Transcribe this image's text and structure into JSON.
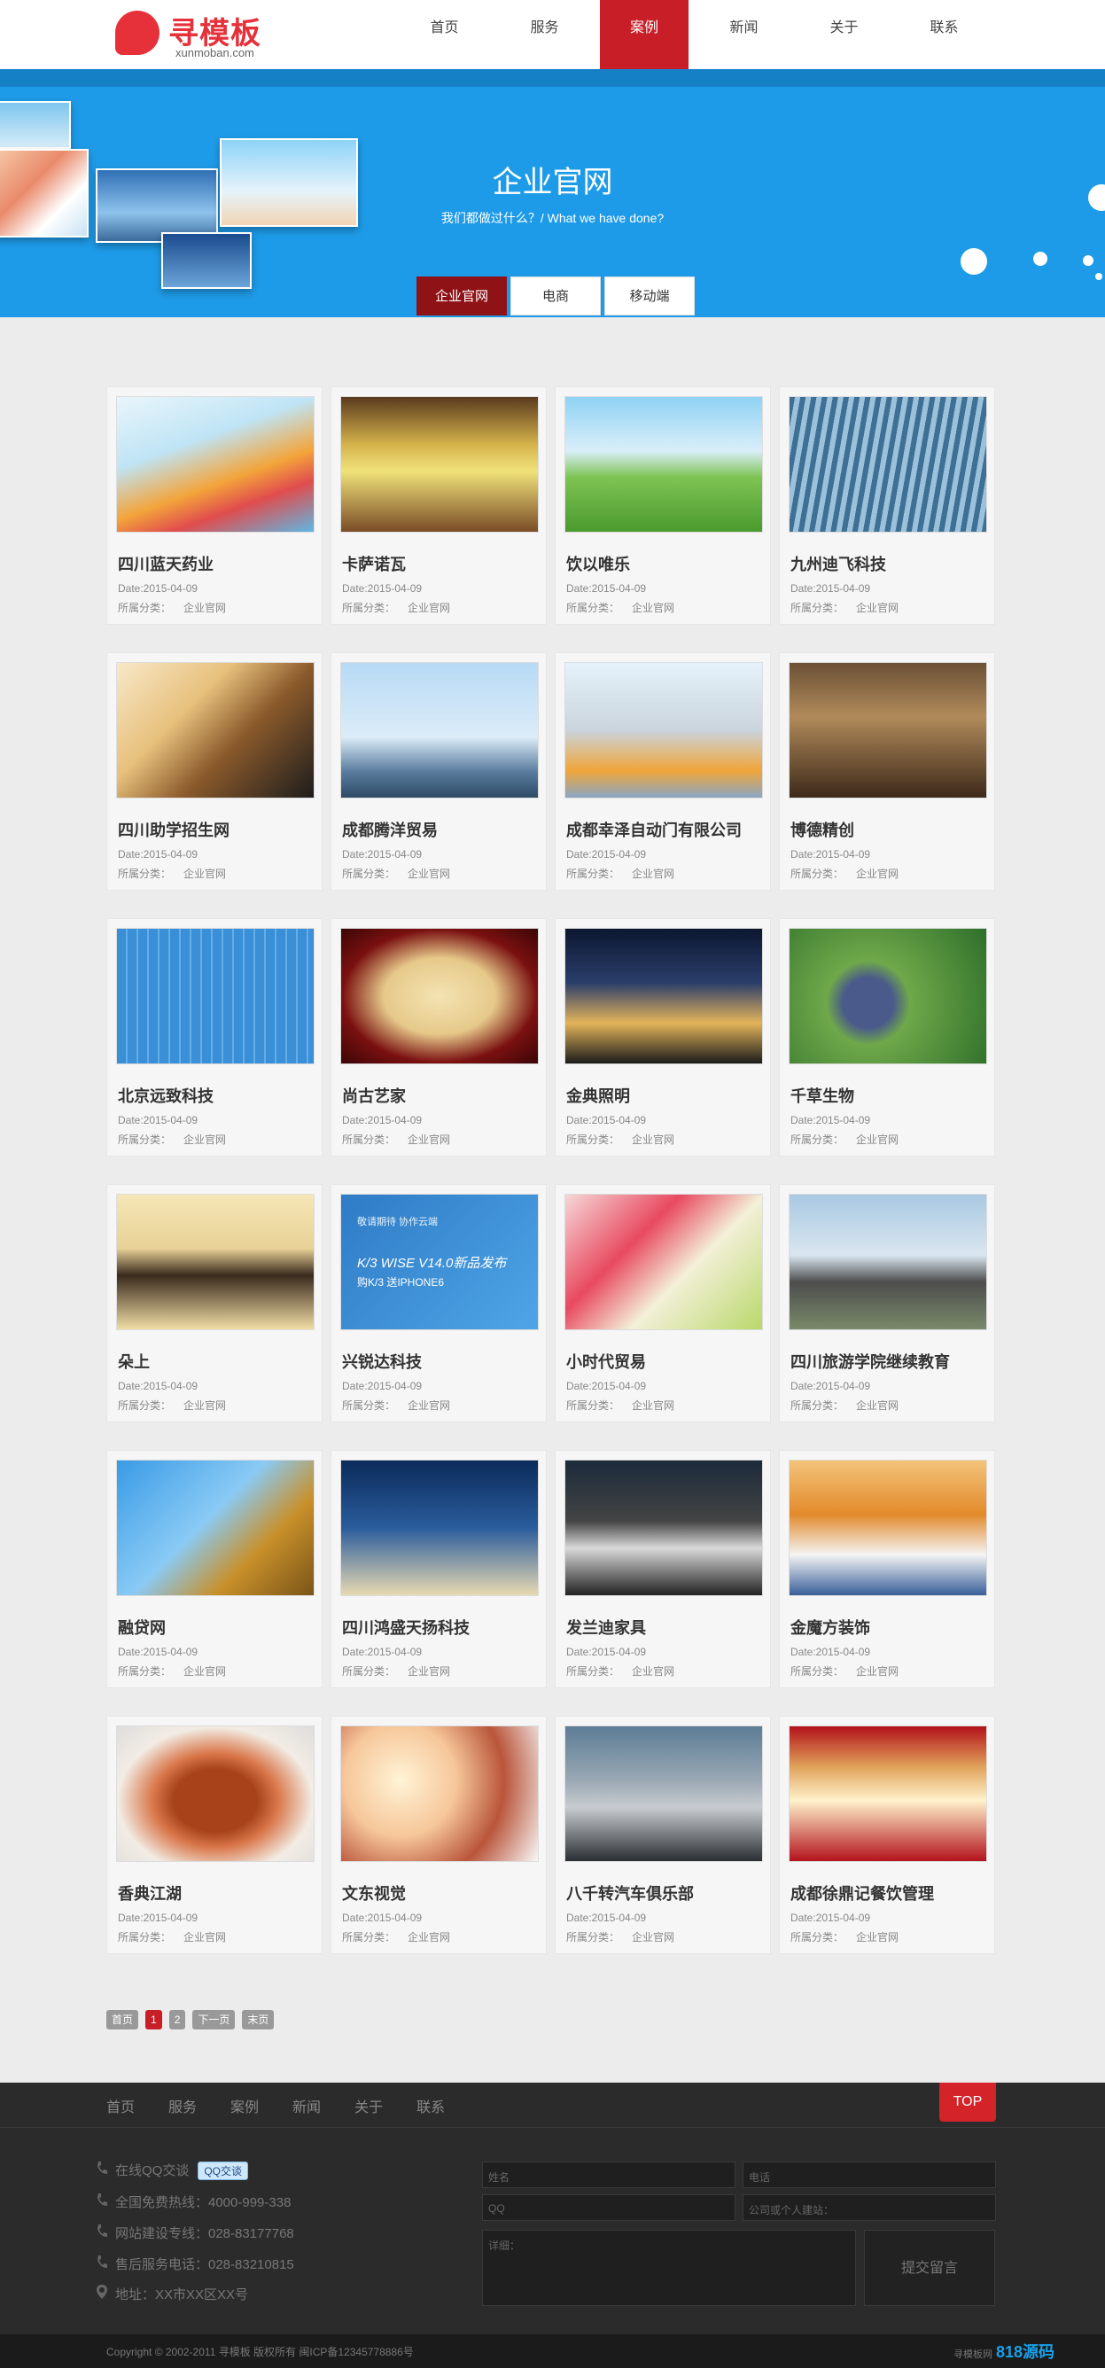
{
  "header": {
    "logo_text": "寻模板",
    "logo_sub": "xunmoban.com",
    "nav": [
      "首页",
      "服务",
      "案例",
      "新闻",
      "关于",
      "联系"
    ],
    "active_nav": "案例"
  },
  "banner": {
    "title": "企业官网",
    "subtitle": "我们都做过什么？/ What we have done?",
    "tabs": [
      "企业官网",
      "电商",
      "移动端"
    ]
  },
  "cases": [
    {
      "title": "四川蓝天药业",
      "date": "Date:2015-04-09",
      "cat_label": "所属分类：",
      "cat": "企业官网",
      "img": "pills"
    },
    {
      "title": "卡萨诺瓦",
      "date": "Date:2015-04-09",
      "cat_label": "所属分类：",
      "cat": "企业官网",
      "img": "room"
    },
    {
      "title": "饮以唯乐",
      "date": "Date:2015-04-09",
      "cat_label": "所属分类：",
      "cat": "企业官网",
      "img": "meadow"
    },
    {
      "title": "九州迪飞科技",
      "date": "Date:2015-04-09",
      "cat_label": "所属分类：",
      "cat": "企业官网",
      "img": "building"
    },
    {
      "title": "四川助学招生网",
      "date": "Date:2015-04-09",
      "cat_label": "所属分类：",
      "cat": "企业官网",
      "img": "graduate"
    },
    {
      "title": "成都腾洋贸易",
      "date": "Date:2015-04-09",
      "cat_label": "所属分类：",
      "cat": "企业官网",
      "img": "city"
    },
    {
      "title": "成都幸泽自动门有限公司",
      "date": "Date:2015-04-09",
      "cat_label": "所属分类：",
      "cat": "企业官网",
      "img": "gates"
    },
    {
      "title": "博德精创",
      "date": "Date:2015-04-09",
      "cat_label": "所属分类：",
      "cat": "企业官网",
      "img": "lounge"
    },
    {
      "title": "北京远致科技",
      "date": "Date:2015-04-09",
      "cat_label": "所属分类：",
      "cat": "企业官网",
      "img": "blueprint"
    },
    {
      "title": "尚古艺家",
      "date": "Date:2015-04-09",
      "cat_label": "所属分类：",
      "cat": "企业官网",
      "img": "scroll"
    },
    {
      "title": "金典照明",
      "date": "Date:2015-04-09",
      "cat_label": "所属分类：",
      "cat": "企业官网",
      "img": "night"
    },
    {
      "title": "千草生物",
      "date": "Date:2015-04-09",
      "cat_label": "所属分类：",
      "cat": "企业官网",
      "img": "berries"
    },
    {
      "title": "朵上",
      "date": "Date:2015-04-09",
      "cat_label": "所属分类：",
      "cat": "企业官网",
      "img": "kid"
    },
    {
      "title": "兴锐达科技",
      "date": "Date:2015-04-09",
      "cat_label": "所属分类：",
      "cat": "企业官网",
      "img": "k3",
      "img_text1": "K/3 WISE V14.0新品发布",
      "img_text2": "购K/3 送IPHONE6",
      "img_text3": "敬请期待 协作云端"
    },
    {
      "title": "小时代贸易",
      "date": "Date:2015-04-09",
      "cat_label": "所属分类：",
      "cat": "企业官网",
      "img": "drinks"
    },
    {
      "title": "四川旅游学院继续教育",
      "date": "Date:2015-04-09",
      "cat_label": "所属分类：",
      "cat": "企业官网",
      "img": "school"
    },
    {
      "title": "融贷网",
      "date": "Date:2015-04-09",
      "cat_label": "所属分类：",
      "cat": "企业官网",
      "img": "money"
    },
    {
      "title": "四川鸿盛天扬科技",
      "date": "Date:2015-04-09",
      "cat_label": "所属分类：",
      "cat": "企业官网",
      "img": "eagle"
    },
    {
      "title": "发兰迪家具",
      "date": "Date:2015-04-09",
      "cat_label": "所属分类：",
      "cat": "企业官网",
      "img": "sofa"
    },
    {
      "title": "金魔方装饰",
      "date": "Date:2015-04-09",
      "cat_label": "所属分类：",
      "cat": "企业官网",
      "img": "office"
    },
    {
      "title": "香典江湖",
      "date": "Date:2015-04-09",
      "cat_label": "所属分类：",
      "cat": "企业官网",
      "img": "duck"
    },
    {
      "title": "文东视觉",
      "date": "Date:2015-04-09",
      "cat_label": "所属分类：",
      "cat": "企业官网",
      "img": "couple"
    },
    {
      "title": "八千转汽车俱乐部",
      "date": "Date:2015-04-09",
      "cat_label": "所属分类：",
      "cat": "企业官网",
      "img": "car"
    },
    {
      "title": "成都徐鼎记餐饮管理",
      "date": "Date:2015-04-09",
      "cat_label": "所属分类：",
      "cat": "企业官网",
      "img": "food"
    }
  ],
  "pager": [
    "首页",
    "1",
    "2",
    "下一页",
    "末页"
  ],
  "footer": {
    "nav": [
      "首页",
      "服务",
      "案例",
      "新闻",
      "关于",
      "联系"
    ],
    "top": "TOP",
    "qq": "在线QQ交谈",
    "qq_btn": "QQ交谈",
    "hotline": "全国免费热线：4000-999-338",
    "web": "网站建设专线：028-83177768",
    "after": "售后服务电话：028-83210815",
    "addr": "地址：XX市XX区XX号",
    "form": {
      "name": "姓名",
      "phone": "电话",
      "qq": "QQ",
      "site": "公司或个人建站：",
      "detail": "详细：",
      "submit": "提交留言"
    },
    "copyright": "Copyright © 2002-2011 寻模板 版权所有    闽ICP备12345778886号",
    "brand_pre": "寻模板网",
    "brand": "818源码"
  },
  "colors": {
    "accent": "#c81e28",
    "banner": "#1e9be8",
    "footer": "#2b2b2b"
  }
}
